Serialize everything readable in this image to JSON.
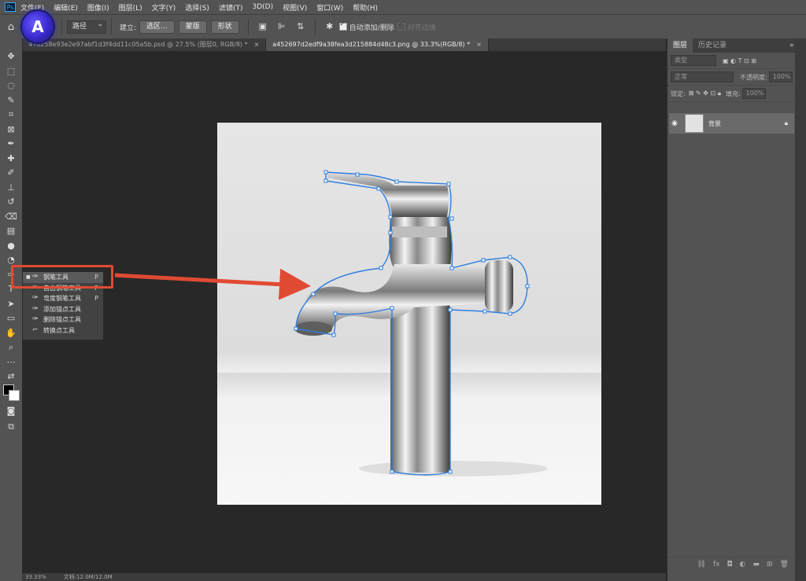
{
  "app": {
    "logo": "Ps"
  },
  "menu": [
    "文件(F)",
    "编辑(E)",
    "图像(I)",
    "图层(L)",
    "文字(Y)",
    "选择(S)",
    "滤镜(T)",
    "3D(D)",
    "视图(V)",
    "窗口(W)",
    "帮助(H)"
  ],
  "overlay_badge": "A",
  "options": {
    "mode": "路径",
    "build_label": "建立:",
    "selection_btn": "选区...",
    "mask_btn": "蒙版",
    "shape_btn": "形状",
    "auto_add": "自动添加/删除",
    "align_edges": "对齐边缘"
  },
  "tabs": [
    {
      "title": "47d258e93e2e97abf1d3f4dd11c05a5b.psd @ 27.5% (图层0, RGB/8) *",
      "close": "×"
    },
    {
      "title": "a452697d2edf9a38fea3d215884d48c3.png @ 33.3%(RGB/8) *",
      "close": "×"
    }
  ],
  "flyout": [
    {
      "label": "钢笔工具",
      "key": "P",
      "icon": "pen-icon",
      "selected": true
    },
    {
      "label": "自由钢笔工具",
      "key": "P",
      "icon": "freeform-pen-icon",
      "selected": false
    },
    {
      "label": "弯度钢笔工具",
      "key": "P",
      "icon": "curvature-pen-icon",
      "selected": false
    },
    {
      "label": "添加锚点工具",
      "key": "",
      "icon": "add-anchor-icon",
      "selected": false
    },
    {
      "label": "删除锚点工具",
      "key": "",
      "icon": "delete-anchor-icon",
      "selected": false
    },
    {
      "label": "转换点工具",
      "key": "",
      "icon": "convert-point-icon",
      "selected": false
    }
  ],
  "panel": {
    "tab_layers": "图层",
    "tab_history": "历史记录",
    "filter_kind": "类型",
    "blend_mode": "正常",
    "opacity_label": "不透明度:",
    "opacity_value": "100%",
    "lock_label": "锁定:",
    "fill_label": "填充:",
    "fill_value": "100%",
    "layer_name": "背景"
  },
  "status": {
    "zoom": "33.33%",
    "doc": "文档:12.0M/12.0M"
  },
  "colors": {
    "accent_red": "#e04a33",
    "path_blue": "#2f7de1"
  }
}
